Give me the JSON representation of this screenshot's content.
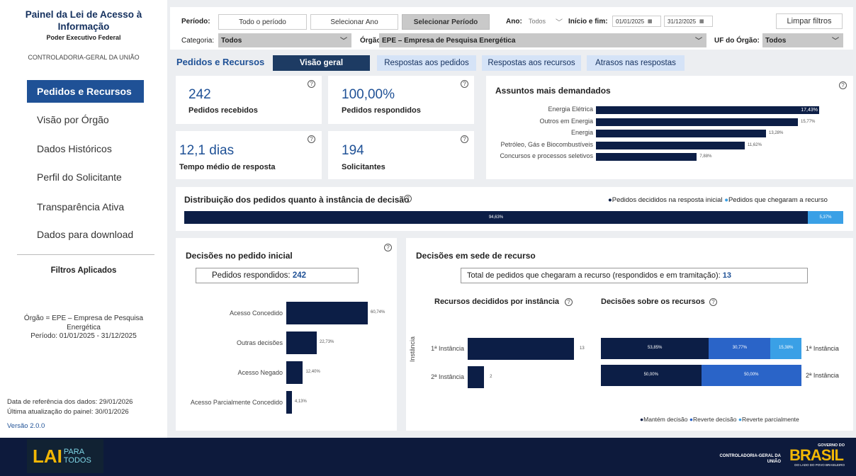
{
  "sidebar": {
    "title": "Painel da Lei de Acesso à Informação",
    "subtitle": "Poder Executivo Federal",
    "org": "CONTROLADORIA-GERAL DA UNIÃO",
    "nav": [
      {
        "label": "Pedidos e Recursos",
        "active": true
      },
      {
        "label": "Visão por Órgão"
      },
      {
        "label": "Dados Históricos"
      },
      {
        "label": "Perfil do Solicitante"
      },
      {
        "label": "Transparência Ativa"
      },
      {
        "label": "Dados para download"
      }
    ],
    "filters_title": "Filtros Aplicados",
    "filters_line1": "Órgão = EPE – Empresa de Pesquisa Energética",
    "filters_line2": "Período: 01/01/2025 - 31/12/2025",
    "ref_date": "Data de referência dos dados:  29/01/2026",
    "update_date": "Última atualização do painel:  30/01/2026",
    "version": "Versão 2.0.0"
  },
  "filters": {
    "periodo_label": "Período:",
    "periodo_opts": [
      "Todo o período",
      "Selecionar Ano",
      "Selecionar Período"
    ],
    "ano_label": "Ano:",
    "ano_value": "Todos",
    "inicio_label": "Início e fim:",
    "inicio": "01/01/2025",
    "fim": "31/12/2025",
    "clear": "Limpar filtros",
    "categoria_label": "Categoria:",
    "categoria_value": "Todos",
    "orgao_label": "Órgão:",
    "orgao_value": "EPE – Empresa de Pesquisa Energética",
    "uf_label": "UF do Órgão:",
    "uf_value": "Todos"
  },
  "tabs": {
    "title": "Pedidos e Recursos",
    "items": [
      "Visão geral",
      "Respostas aos pedidos",
      "Respostas aos recursos",
      "Atrasos nas respostas"
    ]
  },
  "kpis": [
    {
      "value": "242",
      "label": "Pedidos recebidos"
    },
    {
      "value": "100,00%",
      "label": "Pedidos respondidos"
    },
    {
      "value": "12,1 dias",
      "label": "Tempo médio de resposta"
    },
    {
      "value": "194",
      "label": "Solicitantes"
    }
  ],
  "assuntos": {
    "title": "Assuntos mais demandados",
    "items": [
      {
        "label": "Energia Elétrica",
        "value": 17.43,
        "text": "17,43%"
      },
      {
        "label": "Outros em Energia",
        "value": 15.77,
        "text": "15,77%"
      },
      {
        "label": "Energia",
        "value": 13.28,
        "text": "13,28%"
      },
      {
        "label": "Petróleo, Gás e Biocombustíveis",
        "value": 11.62,
        "text": "11,62%"
      },
      {
        "label": "Concursos e processos seletivos",
        "value": 7.88,
        "text": "7,88%"
      }
    ]
  },
  "distribuicao": {
    "title": "Distribuição dos pedidos quanto à instância de decisão",
    "legend1": "Pedidos decididos na resposta inicial",
    "legend2": "Pedidos que chegaram a recurso",
    "v1": 94.63,
    "t1": "94,63%",
    "v2": 5.37,
    "t2": "5,37%"
  },
  "decisoes": {
    "title": "Decisões no pedido inicial",
    "box": "Pedidos respondidos:",
    "box_value": "242",
    "items": [
      {
        "label": "Acesso Concedido",
        "value": 60.74,
        "text": "60,74%"
      },
      {
        "label": "Outras decisões",
        "value": 22.73,
        "text": "22,73%"
      },
      {
        "label": "Acesso Negado",
        "value": 12.4,
        "text": "12,40%"
      },
      {
        "label": "Acesso Parcialmente Concedido",
        "value": 4.13,
        "text": "4,13%"
      }
    ]
  },
  "recurso": {
    "title": "Decisões em sede de recurso",
    "box": "Total de pedidos que chegaram a recurso (respondidos e em tramitação):",
    "box_value": "13",
    "inst_title": "Recursos decididos por instância",
    "inst_axis": "Instância",
    "inst": [
      {
        "label": "1ª Instância",
        "value": 13,
        "text": "13"
      },
      {
        "label": "2ª Instância",
        "value": 2,
        "text": "2"
      }
    ],
    "dec_title": "Decisões sobre os recursos",
    "dec": [
      {
        "label": "1ª Instância",
        "mantem": 53.85,
        "reverte": 30.77,
        "parcial": 15.38,
        "t1": "53,85%",
        "t2": "30,77%",
        "t3": "15,38%"
      },
      {
        "label": "2ª Instância",
        "mantem": 50.0,
        "reverte": 50.0,
        "parcial": 0,
        "t1": "50,00%",
        "t2": "50,00%",
        "t3": ""
      }
    ],
    "legend": [
      "Mantém decisão",
      "Reverte decisão",
      "Reverte parcialmente"
    ]
  },
  "footer": {
    "logo_lai": "LAI",
    "logo_para": "PARA",
    "logo_todos": "TODOS",
    "cgu": "CONTROLADORIA-GERAL DA UNIÃO",
    "gov": "GOVERNO DO",
    "brasil": "BRASIL",
    "slogan": "DO LADO DO POVO BRASILEIRO"
  },
  "colors": {
    "navy": "#0c1e46",
    "blue": "#1f5196",
    "mid": "#2a64c8",
    "light": "#3aa0e6"
  }
}
